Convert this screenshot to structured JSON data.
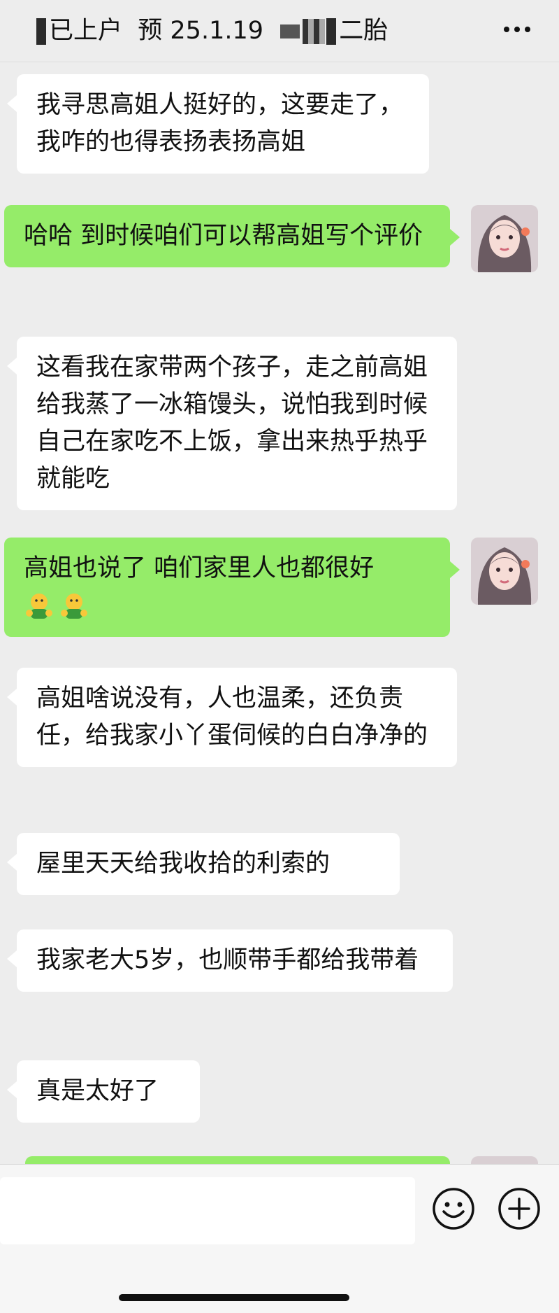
{
  "header": {
    "title_prefix": "已上户",
    "title_date": "预 25.1.19",
    "title_suffix": "二胎",
    "more_icon": "more-dots-icon"
  },
  "messages": [
    {
      "side": "in",
      "text": "我寻思高姐人挺好的，这要走了，我咋的也得表扬表扬高姐"
    },
    {
      "side": "out",
      "text": "哈哈 到时候咱们可以帮高姐写个评价"
    },
    {
      "side": "in",
      "text": "这看我在家带两个孩子，走之前高姐给我蒸了一冰箱馒头，说怕我到时候自己在家吃不上饭，拿出来热乎热乎就能吃"
    },
    {
      "side": "out",
      "text": "高姐也说了 咱们家里人也都很好",
      "emoji": "👐👐"
    },
    {
      "side": "in",
      "text": "高姐啥说没有，人也温柔，还负责任，给我家小丫蛋伺候的白白净净的"
    },
    {
      "side": "in",
      "text": "屋里天天给我收拾的利索的"
    },
    {
      "side": "in",
      "text": "我家老大5岁，也顺带手都给我带着"
    },
    {
      "side": "in",
      "text": "真是太好了"
    }
  ],
  "input": {
    "value": "",
    "emoji_icon": "smiley-icon",
    "add_icon": "plus-circle-icon"
  },
  "colors": {
    "background": "#ededed",
    "outgoing_bubble": "#95ec69",
    "incoming_bubble": "#ffffff"
  }
}
